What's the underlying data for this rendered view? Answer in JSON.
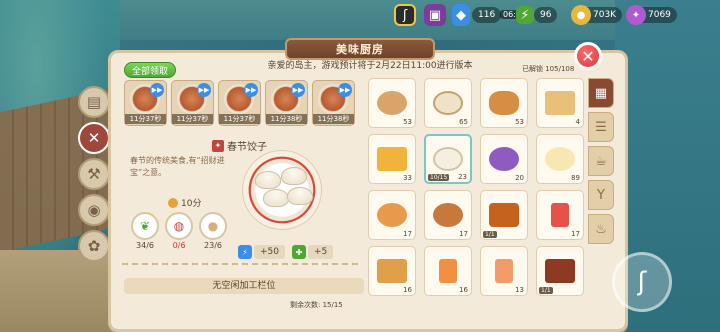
{
  "hud": {
    "clock": "06:11",
    "gems": "116",
    "energy": "96",
    "coins": "703K",
    "points": "7069"
  },
  "header": {
    "title": "美味厨房",
    "notice": "亲爱的岛主，游戏预计将于2月22日11:00进行版本",
    "unlocked": "已解锁 105/108"
  },
  "left": {
    "claim_all": "全部领取",
    "queue": [
      {
        "time": "11分37秒"
      },
      {
        "time": "11分37秒"
      },
      {
        "time": "11分37秒"
      },
      {
        "time": "11分38秒"
      },
      {
        "time": "11分38秒"
      }
    ],
    "recipe_name": "春节饺子",
    "description": "春节的传统美食,有“招财进宝”之意。",
    "cook_time": "10分",
    "ingredients": [
      {
        "icon": "vegetable-icon",
        "count": "34/6"
      },
      {
        "icon": "meat-icon",
        "count": "0/6"
      },
      {
        "icon": "dough-icon",
        "count": "23/6"
      }
    ],
    "energy_reward": "+50",
    "exp_reward": "+5",
    "no_slot": "无空闲加工栏位",
    "remaining": "剩余次数: 15/15"
  },
  "grid": [
    {
      "name": "bread",
      "count": "53",
      "color": "#d8a46a"
    },
    {
      "name": "flour",
      "count": "65",
      "color": "#efe2c6"
    },
    {
      "name": "baguette",
      "count": "53",
      "color": "#d68e44"
    },
    {
      "name": "cake",
      "count": "4",
      "color": "#e8c07a"
    },
    {
      "name": "fries",
      "count": "33",
      "color": "#f0b43c"
    },
    {
      "name": "dumplings",
      "count": "23",
      "progress": "10/15",
      "color": "#f5efe2",
      "selected": true
    },
    {
      "name": "fruit-salad",
      "count": "20",
      "color": "#8e5cc0"
    },
    {
      "name": "eggs",
      "count": "89",
      "color": "#f7e7b2"
    },
    {
      "name": "fried-shrimp",
      "count": "17",
      "color": "#e89a4a"
    },
    {
      "name": "soup",
      "count": "17",
      "color": "#c9783c"
    },
    {
      "name": "fried-chicken",
      "count": "",
      "progress": "1/1",
      "color": "#c4621e"
    },
    {
      "name": "juice",
      "count": "17",
      "color": "#e8504a"
    },
    {
      "name": "spring-rolls",
      "count": "16",
      "color": "#e0a04a"
    },
    {
      "name": "orange-drink",
      "count": "16",
      "color": "#f09040"
    },
    {
      "name": "peach-drink",
      "count": "13",
      "color": "#f29c6a"
    },
    {
      "name": "skewers",
      "count": "",
      "progress": "1/1",
      "color": "#8e3a22"
    }
  ],
  "categories": [
    {
      "icon": "grid-icon",
      "active": true
    },
    {
      "icon": "burger-icon",
      "active": false
    },
    {
      "icon": "drink-icon",
      "active": false
    },
    {
      "icon": "cocktail-icon",
      "active": false
    },
    {
      "icon": "pot-icon",
      "active": false
    }
  ]
}
